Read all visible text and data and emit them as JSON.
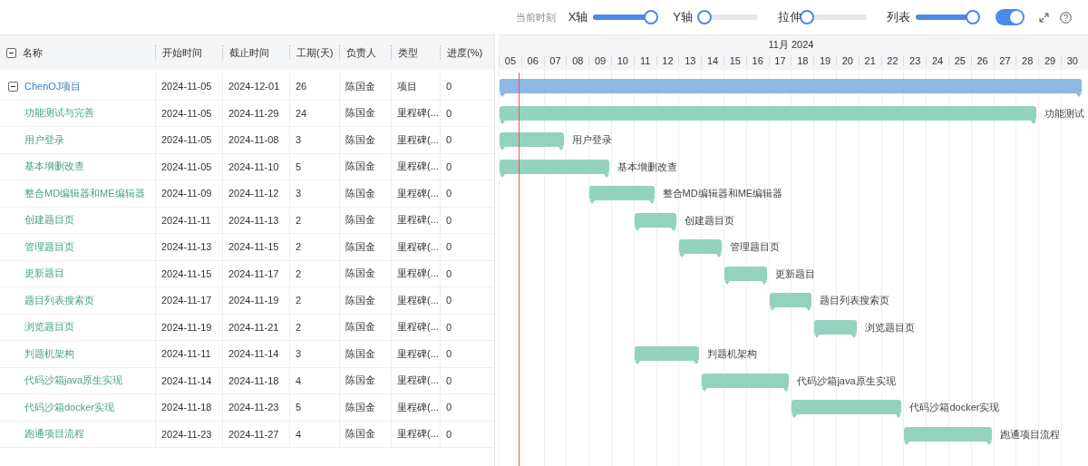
{
  "toolbar": {
    "current_time_label": "当前时刻",
    "sliders": [
      {
        "label": "X轴",
        "level": 0.97
      },
      {
        "label": "Y轴",
        "level": 0.1
      },
      {
        "label": "拉伸",
        "level": 0
      },
      {
        "label": "列表",
        "level": 0.96
      }
    ],
    "toggle": {
      "on": true
    }
  },
  "table": {
    "columns": [
      "名称",
      "开始时间",
      "截止时间",
      "工期(天)",
      "负责人",
      "类型",
      "进度(%)"
    ],
    "header_expanded": true,
    "rows": [
      {
        "kind": "project",
        "name": "ChenOJ项目",
        "start": "2024-11-05",
        "end": "2024-12-01",
        "duration": "26",
        "owner": "陈国金",
        "type": "项目",
        "progress": "0",
        "expanded": true,
        "children": [
          {
            "kind": "milestone",
            "name": "功能测试与完善",
            "start": "2024-11-05",
            "end": "2024-11-29",
            "duration": "24",
            "owner": "陈国金",
            "type": "里程碑(...",
            "progress": "0",
            "bar_label": "功能测试"
          },
          {
            "kind": "milestone",
            "name": "用户登录",
            "start": "2024-11-05",
            "end": "2024-11-08",
            "duration": "3",
            "owner": "陈国金",
            "type": "里程碑(...",
            "progress": "0",
            "bar_label": "用户登录"
          },
          {
            "kind": "milestone",
            "name": "基本增删改查",
            "start": "2024-11-05",
            "end": "2024-11-10",
            "duration": "5",
            "owner": "陈国金",
            "type": "里程碑(...",
            "progress": "0",
            "bar_label": "基本增删改查"
          },
          {
            "kind": "milestone",
            "name": "整合MD编辑器和ME编辑器",
            "start": "2024-11-09",
            "end": "2024-11-12",
            "duration": "3",
            "owner": "陈国金",
            "type": "里程碑(...",
            "progress": "0",
            "bar_label": "整合MD编辑器和ME编辑器"
          },
          {
            "kind": "milestone",
            "name": "创建题目页",
            "start": "2024-11-11",
            "end": "2024-11-13",
            "duration": "2",
            "owner": "陈国金",
            "type": "里程碑(...",
            "progress": "0",
            "bar_label": "创建题目页"
          },
          {
            "kind": "milestone",
            "name": "管理题目页",
            "start": "2024-11-13",
            "end": "2024-11-15",
            "duration": "2",
            "owner": "陈国金",
            "type": "里程碑(...",
            "progress": "0",
            "bar_label": "管理题目页"
          },
          {
            "kind": "milestone",
            "name": "更新题目",
            "start": "2024-11-15",
            "end": "2024-11-17",
            "duration": "2",
            "owner": "陈国金",
            "type": "里程碑(...",
            "progress": "0",
            "bar_label": "更新题目"
          },
          {
            "kind": "milestone",
            "name": "题目列表搜索页",
            "start": "2024-11-17",
            "end": "2024-11-19",
            "duration": "2",
            "owner": "陈国金",
            "type": "里程碑(...",
            "progress": "0",
            "bar_label": "题目列表搜索页"
          },
          {
            "kind": "milestone",
            "name": "浏览题目页",
            "start": "2024-11-19",
            "end": "2024-11-21",
            "duration": "2",
            "owner": "陈国金",
            "type": "里程碑(...",
            "progress": "0",
            "bar_label": "浏览题目页"
          },
          {
            "kind": "milestone",
            "name": "判题机架构",
            "start": "2024-11-11",
            "end": "2024-11-14",
            "duration": "3",
            "owner": "陈国金",
            "type": "里程碑(...",
            "progress": "0",
            "bar_label": "判题机架构"
          },
          {
            "kind": "milestone",
            "name": "代码沙箱java原生实现",
            "start": "2024-11-14",
            "end": "2024-11-18",
            "duration": "4",
            "owner": "陈国金",
            "type": "里程碑(...",
            "progress": "0",
            "bar_label": "代码沙箱java原生实现"
          },
          {
            "kind": "milestone",
            "name": "代码沙箱docker实现",
            "start": "2024-11-18",
            "end": "2024-11-23",
            "duration": "5",
            "owner": "陈国金",
            "type": "里程碑(...",
            "progress": "0",
            "bar_label": "代码沙箱docker实现"
          },
          {
            "kind": "milestone",
            "name": "跑通项目流程",
            "start": "2024-11-23",
            "end": "2024-11-27",
            "duration": "4",
            "owner": "陈国金",
            "type": "里程碑(...",
            "progress": "0",
            "bar_label": "跑通项目流程"
          }
        ]
      }
    ]
  },
  "gantt": {
    "month": "11月 2024",
    "days": [
      "05",
      "06",
      "07",
      "08",
      "09",
      "10",
      "11",
      "12",
      "13",
      "14",
      "15",
      "16",
      "17",
      "18",
      "19",
      "20",
      "21",
      "22",
      "23",
      "24",
      "25",
      "26",
      "27",
      "28",
      "29",
      "30"
    ],
    "today_line": true
  }
}
